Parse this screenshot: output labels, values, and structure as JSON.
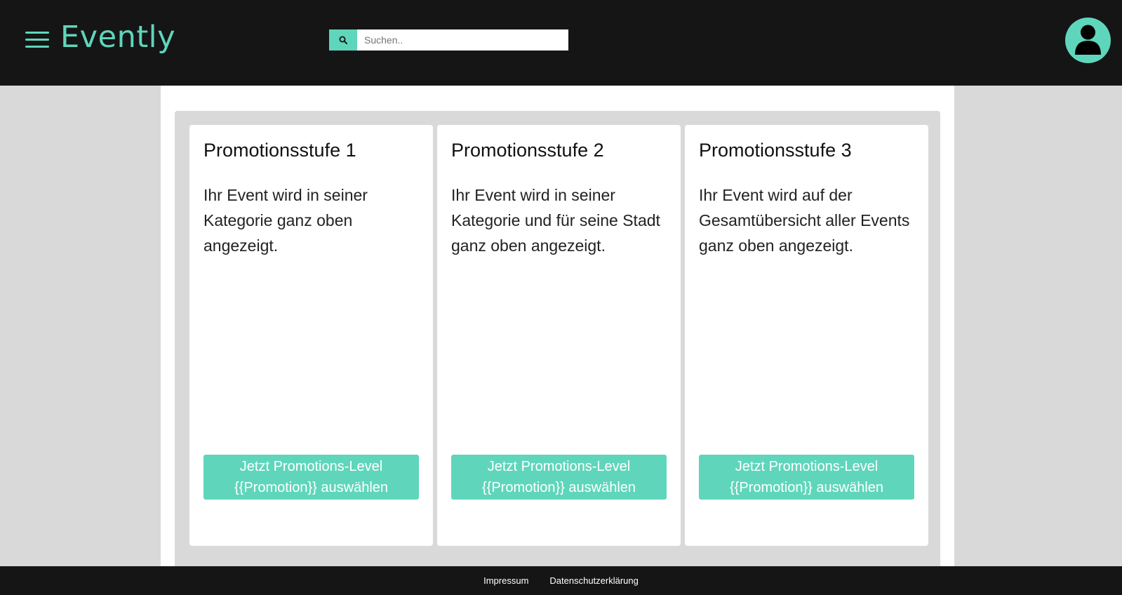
{
  "brand": {
    "name": "Evently",
    "accent_color": "#5fd6bb",
    "header_bg": "#151515"
  },
  "header": {
    "menu_icon": "hamburger-menu-icon",
    "search": {
      "placeholder": "Suchen..",
      "value": "",
      "icon": "search-icon"
    },
    "avatar_icon": "user-avatar-icon"
  },
  "promotions": [
    {
      "title": "Promotionsstufe 1",
      "description": "Ihr Event wird in seiner Kategorie ganz oben angezeigt.",
      "button_label": "Jetzt Promotions-Level {{Promotion}} auswählen"
    },
    {
      "title": "Promotionsstufe 2",
      "description": "Ihr Event wird in seiner Kategorie und für seine Stadt ganz oben angezeigt.",
      "button_label": "Jetzt Promotions-Level {{Promotion}} auswählen"
    },
    {
      "title": "Promotionsstufe 3",
      "description": "Ihr Event wird auf der Gesamtübersicht aller Events ganz oben angezeigt.",
      "button_label": "Jetzt Promotions-Level {{Promotion}} auswählen"
    }
  ],
  "footer": {
    "links": [
      {
        "label": "Impressum"
      },
      {
        "label": "Datenschutzerklärung"
      }
    ]
  }
}
